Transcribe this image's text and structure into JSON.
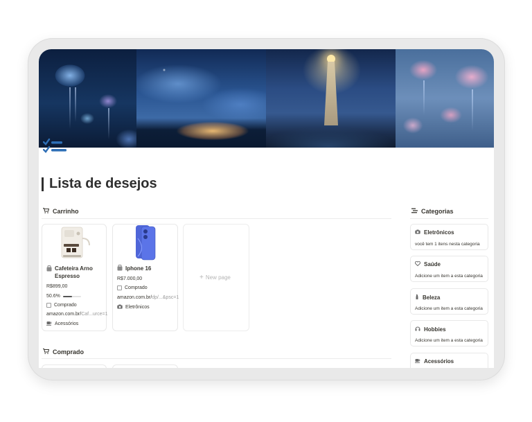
{
  "page": {
    "title": "Lista de desejos"
  },
  "sections": {
    "carrinho": "Carrinho",
    "comprado": "Comprado",
    "categorias": "Categorias"
  },
  "cards": [
    {
      "name_line1": "Cafeteira Arno",
      "name_line2": "Espresso",
      "price": "R$899,00",
      "percent": "50.6%",
      "percent_value": 0.506,
      "checkbox_label": "Comprado",
      "link_prefix": "amazon.com.br/",
      "link_suffix": "Caf...urce=1",
      "category": "Acessórios"
    },
    {
      "name_line1": "Iphone 16",
      "price": "R$7.000,00",
      "checkbox_label": "Comprado",
      "link_prefix": "amazon.com.br/",
      "link_suffix": "dp/...&psc=1",
      "category": "Eletrônicos"
    }
  ],
  "new_page": {
    "label": "New page",
    "icon": "plus-icon"
  },
  "categories": [
    {
      "name": "Eletrônicos",
      "desc": "você tem 1 itens nesta categoria",
      "icon": "camera-icon"
    },
    {
      "name": "Saúde",
      "desc": "Adicione um item a esta categoria",
      "icon": "heart-icon"
    },
    {
      "name": "Beleza",
      "desc": "Adicione um item a esta categoria",
      "icon": "lipstick-icon"
    },
    {
      "name": "Hobbies",
      "desc": "Adicione um item a esta categoria",
      "icon": "headphones-icon"
    },
    {
      "name": "Acessórios",
      "desc": "",
      "icon": "coffee-icon"
    }
  ],
  "colors": {
    "accent": "#2e6fb6",
    "text": "#37352f",
    "border": "#e8e8e8"
  }
}
